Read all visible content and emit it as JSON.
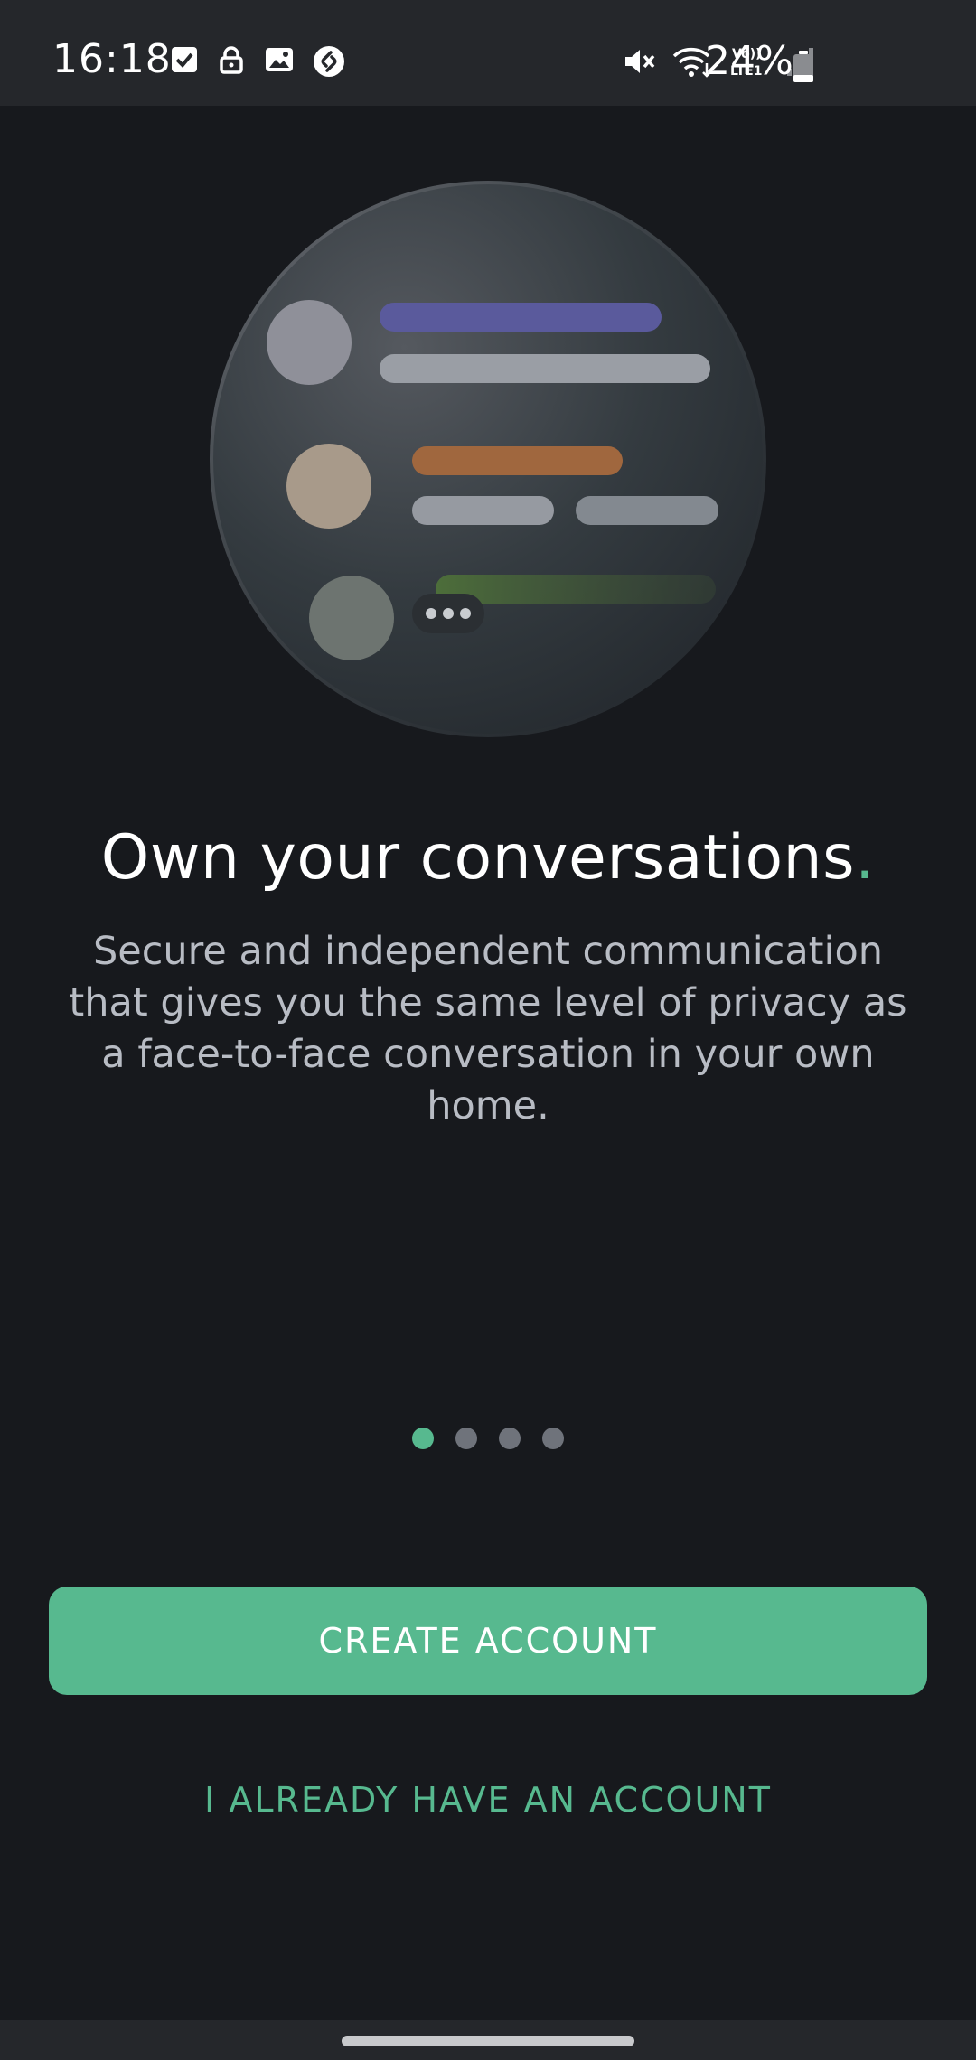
{
  "status_bar": {
    "time": "16:18",
    "left_icons": [
      "checkbox-icon",
      "lock-icon",
      "image-icon",
      "shazam-icon"
    ],
    "right_icons": [
      "mute-icon",
      "wifi-icon",
      "volte-icon",
      "signal-icon"
    ],
    "volte_label": "Vo)) LTE1",
    "battery_percent": "24%",
    "battery_level": 0.24
  },
  "onboarding": {
    "title": "Own your conversations",
    "title_dot": ".",
    "subtitle": "Secure and independent communication that gives you the same level of privacy as a face-to-face conversation in your own home.",
    "page_count": 4,
    "active_page": 1
  },
  "actions": {
    "create_account": "CREATE ACCOUNT",
    "already_have_account": "I ALREADY HAVE AN ACCOUNT"
  },
  "colors": {
    "accent": "#57b98f",
    "background": "#17191d",
    "status_bar": "#25272b"
  }
}
